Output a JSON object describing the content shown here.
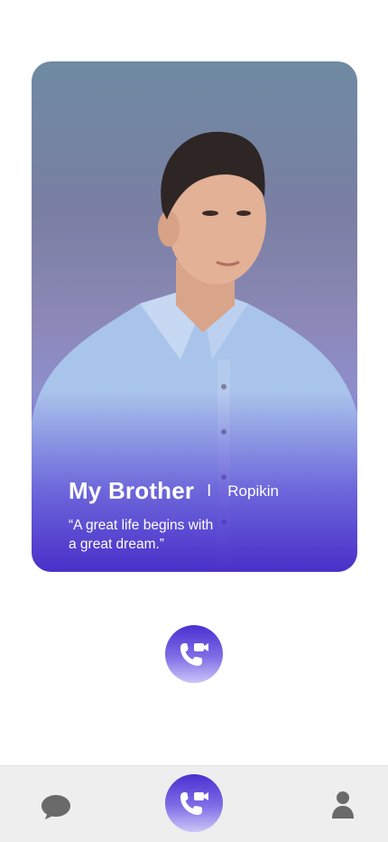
{
  "profile": {
    "name": "My Brother",
    "separator": "I",
    "handle": "Ropikin",
    "quote_line1": "“A great life begins with",
    "quote_line2": "a great dream.”"
  },
  "actions": {
    "call_icon": "video-call-icon"
  },
  "bottom_nav": {
    "items": [
      {
        "id": "chat",
        "icon": "chat-bubble-icon"
      },
      {
        "id": "call",
        "icon": "video-call-icon",
        "active": true
      },
      {
        "id": "profile",
        "icon": "person-icon"
      }
    ]
  },
  "colors": {
    "accent": "#4a2fd0",
    "accent_light": "#cbc6f8",
    "nav_background": "#eeeeee",
    "nav_icon": "#6a6a6a"
  }
}
